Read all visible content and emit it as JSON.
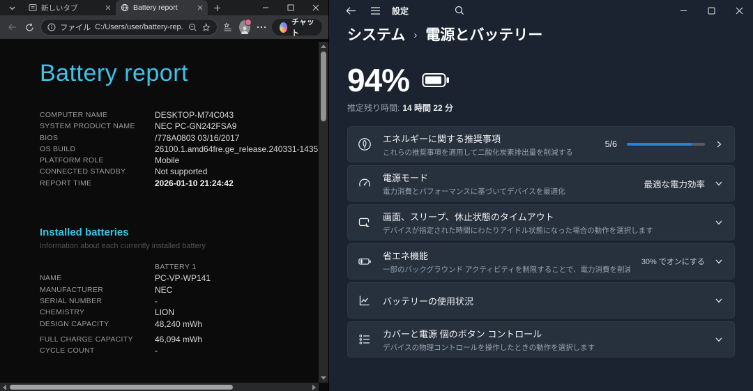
{
  "browser": {
    "tabs": [
      {
        "label": "新しいタブ"
      },
      {
        "label": "Battery report",
        "active": true
      }
    ],
    "toolbar": {
      "scheme_label": "ファイル",
      "url": "C:/Users/user/battery-rep...",
      "chat_label": "チャット"
    },
    "page": {
      "title": "Battery report",
      "system_info": [
        {
          "label": "COMPUTER NAME",
          "value": "DESKTOP-M74C043"
        },
        {
          "label": "SYSTEM PRODUCT NAME",
          "value": "NEC PC-GN242FSA9"
        },
        {
          "label": "BIOS",
          "value": "/778A0803 03/16/2017"
        },
        {
          "label": "OS BUILD",
          "value": "26100.1.amd64fre.ge_release.240331-1435"
        },
        {
          "label": "PLATFORM ROLE",
          "value": "Mobile"
        },
        {
          "label": "CONNECTED STANDBY",
          "value": "Not supported"
        },
        {
          "label": "REPORT TIME",
          "value": "2026-01-10  21:24:42",
          "bold": true
        }
      ],
      "installed_batteries": {
        "heading": "Installed batteries",
        "subtitle": "Information about each currently installed battery",
        "rows": [
          {
            "label": "",
            "value": "BATTERY 1",
            "header": true
          },
          {
            "label": "NAME",
            "value": "PC-VP-WP141"
          },
          {
            "label": "MANUFACTURER",
            "value": "NEC"
          },
          {
            "label": "SERIAL NUMBER",
            "value": "-"
          },
          {
            "label": "CHEMISTRY",
            "value": "LION"
          },
          {
            "label": "DESIGN CAPACITY",
            "value": "48,240 mWh"
          },
          {
            "label": "FULL CHARGE CAPACITY",
            "value": "46,094 mWh",
            "gap": true
          },
          {
            "label": "CYCLE COUNT",
            "value": "-"
          }
        ]
      }
    }
  },
  "settings": {
    "titlebar": {
      "app_label": "設定"
    },
    "breadcrumb": {
      "parent": "システム",
      "separator": "›",
      "current": "電源とバッテリー"
    },
    "battery_status": {
      "percent": "94%",
      "remaining_label": "推定残り時間:",
      "remaining_value": "14 時間 22 分"
    },
    "cards": [
      {
        "icon": "leaf-icon",
        "title": "エネルギーに関する推奨事項",
        "subtitle": "これらの推奨事項を適用して二酸化炭素排出量を削減する",
        "value": "5/6",
        "progress_percent": 83,
        "chevron": "right"
      },
      {
        "icon": "gauge-icon",
        "title": "電源モード",
        "subtitle": "電力消費とパフォーマンスに基づいてデバイスを最適化",
        "value": "最適な電力効率",
        "chevron": "down"
      },
      {
        "icon": "screen-sleep-icon",
        "title": "画面、スリープ、休止状態のタイムアウト",
        "subtitle": "デバイスが指定された時間にわたりアイドル状態になった場合の動作を選択します",
        "chevron": "down"
      },
      {
        "icon": "battery-eco-icon",
        "title": "省エネ機能",
        "subtitle": "一部のバックグラウンド アクティビティを制限することで、電力消費を削減し、バッテリーの寿命を延ばす",
        "value": "30% でオンにする",
        "chevron": "down"
      },
      {
        "icon": "chart-icon",
        "title": "バッテリーの使用状況",
        "chevron": "down"
      },
      {
        "icon": "controls-list-icon",
        "title": "カバーと電源 個のボタン コントロール",
        "subtitle": "デバイスの物理コントロールを操作したときの動作を選択します",
        "chevron": "down"
      }
    ],
    "colors": {
      "accent_blue": "#2a80d8",
      "report_accent": "#3bc3e8"
    }
  }
}
